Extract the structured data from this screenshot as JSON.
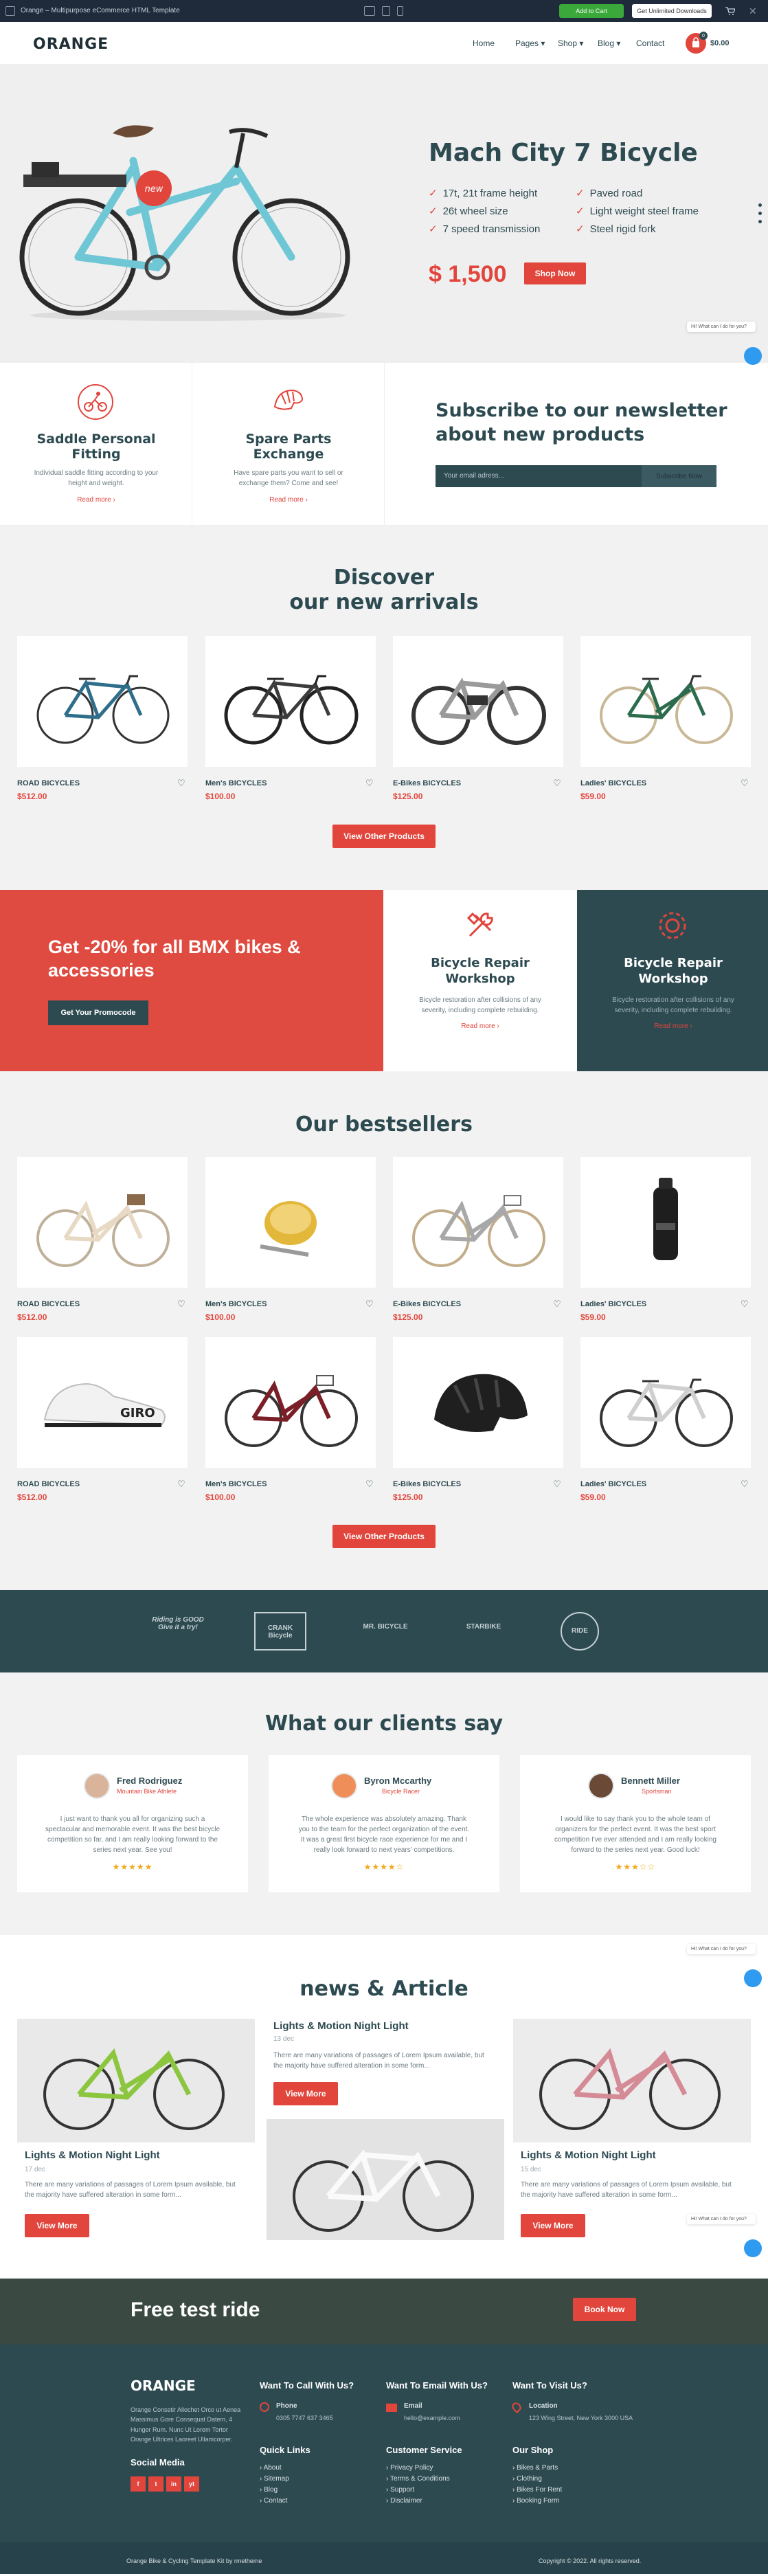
{
  "preview": {
    "title": "Orange – Multipurpose eCommerce HTML Template",
    "add_to_cart": "Add to Cart",
    "unlimited": "Get Unlimited Downloads"
  },
  "header": {
    "logo": "ORANGE",
    "nav": [
      "Home",
      "Pages",
      "Shop",
      "Blog",
      "Contact"
    ],
    "cart_count": "0",
    "cart_total": "$0.00"
  },
  "hero": {
    "badge": "new",
    "title": "Mach City 7 Bicycle",
    "features": [
      "17t, 21t frame height",
      "Paved road",
      "26t wheel size",
      "Light weight steel frame",
      "7 speed transmission",
      "Steel rigid fork"
    ],
    "price": "$ 1,500",
    "button": "Shop Now"
  },
  "chat": {
    "bubble": "Hi! What can I do for you?"
  },
  "services": [
    {
      "title": "Saddle Personal Fitting",
      "text": "Individual saddle fitting according to your height and weight.",
      "link": "Read more"
    },
    {
      "title": "Spare Parts Exchange",
      "text": "Have spare parts you want to sell or exchange them? Come and see!",
      "link": "Read more"
    }
  ],
  "newsletter": {
    "title": "Subscribe to our newsletter about new products",
    "placeholder": "Your email adress...",
    "button": "Subscribe Now"
  },
  "arrivals": {
    "title_line1": "Discover",
    "title_line2": "our new arrivals",
    "products": [
      {
        "category": "ROAD BICYCLES",
        "price": "$512.00"
      },
      {
        "category": "Men's BICYCLES",
        "price": "$100.00"
      },
      {
        "category": "E-Bikes BICYCLES",
        "price": "$125.00"
      },
      {
        "category": "Ladies' BICYCLES",
        "price": "$59.00"
      }
    ],
    "button": "View Other Products"
  },
  "promo": {
    "title": "Get -20% for all BMX bikes & accessories",
    "button": "Get Your Promocode",
    "cards": [
      {
        "title": "Bicycle Repair Workshop",
        "text": "Bicycle restoration after collisions of any severity, including complete rebuilding.",
        "link": "Read more"
      },
      {
        "title": "Bicycle Repair Workshop",
        "text": "Bicycle restoration after collisions of any severity, including complete rebuilding.",
        "link": "Read more"
      }
    ]
  },
  "bestsellers": {
    "title": "Our bestsellers",
    "products": [
      {
        "category": "ROAD BICYCLES",
        "price": "$512.00"
      },
      {
        "category": "Men's BICYCLES",
        "price": "$100.00"
      },
      {
        "category": "E-Bikes BICYCLES",
        "price": "$125.00"
      },
      {
        "category": "Ladies' BICYCLES",
        "price": "$59.00"
      },
      {
        "category": "ROAD BICYCLES",
        "price": "$512.00"
      },
      {
        "category": "Men's BICYCLES",
        "price": "$100.00"
      },
      {
        "category": "E-Bikes BICYCLES",
        "price": "$125.00"
      },
      {
        "category": "Ladies' BICYCLES",
        "price": "$59.00"
      }
    ],
    "button": "View Other Products"
  },
  "brands": [
    "Riding is GOOD Give it a try!",
    "CRANK Bicycle",
    "MR. BICYCLE",
    "STARBIKE",
    "RIDE"
  ],
  "testimonials": {
    "title": "What our clients say",
    "items": [
      {
        "name": "Fred Rodriguez",
        "role": "Mountain Bike Athlete",
        "text": "I just want to thank you all for organizing such a spectacular and memorable event. It was the best bicycle competition so far, and I am really looking forward to the series next year. See you!",
        "rating": 5
      },
      {
        "name": "Byron Mccarthy",
        "role": "Bicycle Racer",
        "text": "The whole experience was absolutely amazing. Thank you to the team for the perfect organization of the event. It was a great first bicycle race experience for me and I really look forward to next years' competitions.",
        "rating": 4
      },
      {
        "name": "Bennett Miller",
        "role": "Sportsman",
        "text": "I would like to say thank you to the whole team of organizers for the perfect event. It was the best sport competition I've ever attended and I am really looking forward to the series next year. Good luck!",
        "rating": 3
      }
    ]
  },
  "news": {
    "title": "news & Article",
    "items": [
      {
        "title": "Lights & Motion Night Light",
        "date": "17 dec",
        "text": "There are many variations of passages of Lorem Ipsum available, but the majority have suffered alteration in some form...",
        "button": "View More"
      },
      {
        "title": "Lights & Motion Night Light",
        "date": "13 dec",
        "text": "There are many variations of passages of Lorem Ipsum available, but the majority have suffered alteration in some form...",
        "button": "View More"
      },
      {
        "title": "Lights & Motion Night Light",
        "date": "15 dec",
        "text": "There are many variations of passages of Lorem Ipsum available, but the majority have suffered alteration in some form...",
        "button": "View More"
      }
    ]
  },
  "ride": {
    "title": "Free test ride",
    "button": "Book Now"
  },
  "footer": {
    "logo": "ORANGE",
    "about": "Orange Consetir Allochet Orco ut Aenea Massimus Gore Consequat Datem, 4 Hunger Rum. Nunc Ut Lorem Tortor Orange Ultrices Laoreet Ullamcorper.",
    "social_title": "Social Media",
    "social": [
      "f",
      "t",
      "in",
      "yt"
    ],
    "call_head": "Want To Call With Us?",
    "call_label": "Phone",
    "call_value": "0305 7747 637 3465",
    "email_head": "Want To Email With Us?",
    "email_label": "Email",
    "email_value": "hello@example.com",
    "visit_head": "Want To Visit Us?",
    "visit_label": "Location",
    "visit_value": "123 Wing Street, New York 3000 USA",
    "quick_head": "Quick Links",
    "quick": [
      "About",
      "Sitemap",
      "Blog",
      "Contact"
    ],
    "service_head": "Customer Service",
    "service": [
      "Privacy Policy",
      "Terms & Conditions",
      "Support",
      "Disclaimer"
    ],
    "shop_head": "Our Shop",
    "shop": [
      "Bikes & Parts",
      "Clothing",
      "Bikes For Rent",
      "Booking Form"
    ],
    "bottom_left": "Orange Bike & Cycling Template Kit by rmetheme",
    "bottom_right": "Copyright © 2022. All rights reserved."
  }
}
